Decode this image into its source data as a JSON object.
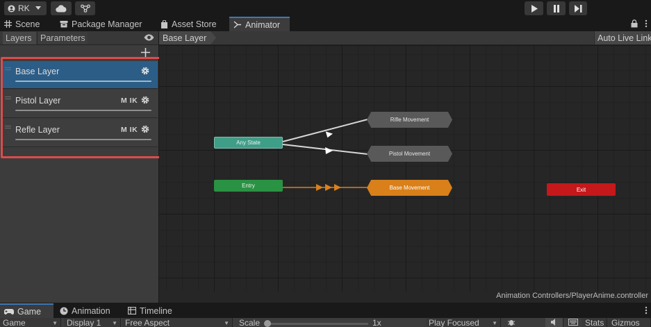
{
  "toolbar": {
    "account_label": "RK",
    "icons": [
      "account-icon",
      "caret-down-icon",
      "cloud-icon",
      "collab-icon",
      "play-icon",
      "pause-icon",
      "step-icon"
    ]
  },
  "top_tabs": [
    {
      "label": "Scene",
      "icon": "grid-icon",
      "active": false
    },
    {
      "label": "Package Manager",
      "icon": "package-icon",
      "active": false
    },
    {
      "label": "Asset Store",
      "icon": "store-icon",
      "active": false
    },
    {
      "label": "Animator",
      "icon": "animator-icon",
      "active": true
    }
  ],
  "left_panel": {
    "tabs": [
      "Layers",
      "Parameters"
    ],
    "active_tab": "Layers",
    "layers": [
      {
        "name": "Base Layer",
        "modifiers": "",
        "selected": true
      },
      {
        "name": "Pistol Layer",
        "modifiers": "M IK",
        "selected": false
      },
      {
        "name": "Refle Layer",
        "modifiers": "M IK",
        "selected": false
      }
    ],
    "highlight_color": "#e04a4a"
  },
  "graph": {
    "breadcrumb": "Base Layer",
    "auto_live_link": "Auto Live Link",
    "controller_path": "Animation Controllers/PlayerAnime.controller",
    "nodes": {
      "any_state": "Any State",
      "entry": "Entry",
      "rifle": "Rifle Movement",
      "pistol": "Pistol Movement",
      "base": "Base Movement",
      "exit": "Exit"
    },
    "colors": {
      "any_state": "#3f9e88",
      "entry": "#2a9243",
      "state": "#595959",
      "default_state": "#d9801b",
      "exit": "#c4181b",
      "transition": "#d8d8d8",
      "default_transition": "#d9801b"
    }
  },
  "bottom_tabs": [
    {
      "label": "Game",
      "icon": "gamepad-icon",
      "active": true
    },
    {
      "label": "Animation",
      "icon": "clock-icon",
      "active": false
    },
    {
      "label": "Timeline",
      "icon": "timeline-icon",
      "active": false
    }
  ],
  "game_bar": {
    "mode": "Game",
    "display": "Display 1",
    "aspect": "Free Aspect",
    "scale_label": "Scale",
    "scale_value": "1x",
    "play_mode": "Play Focused",
    "stats": "Stats",
    "gizmos": "Gizmos"
  }
}
